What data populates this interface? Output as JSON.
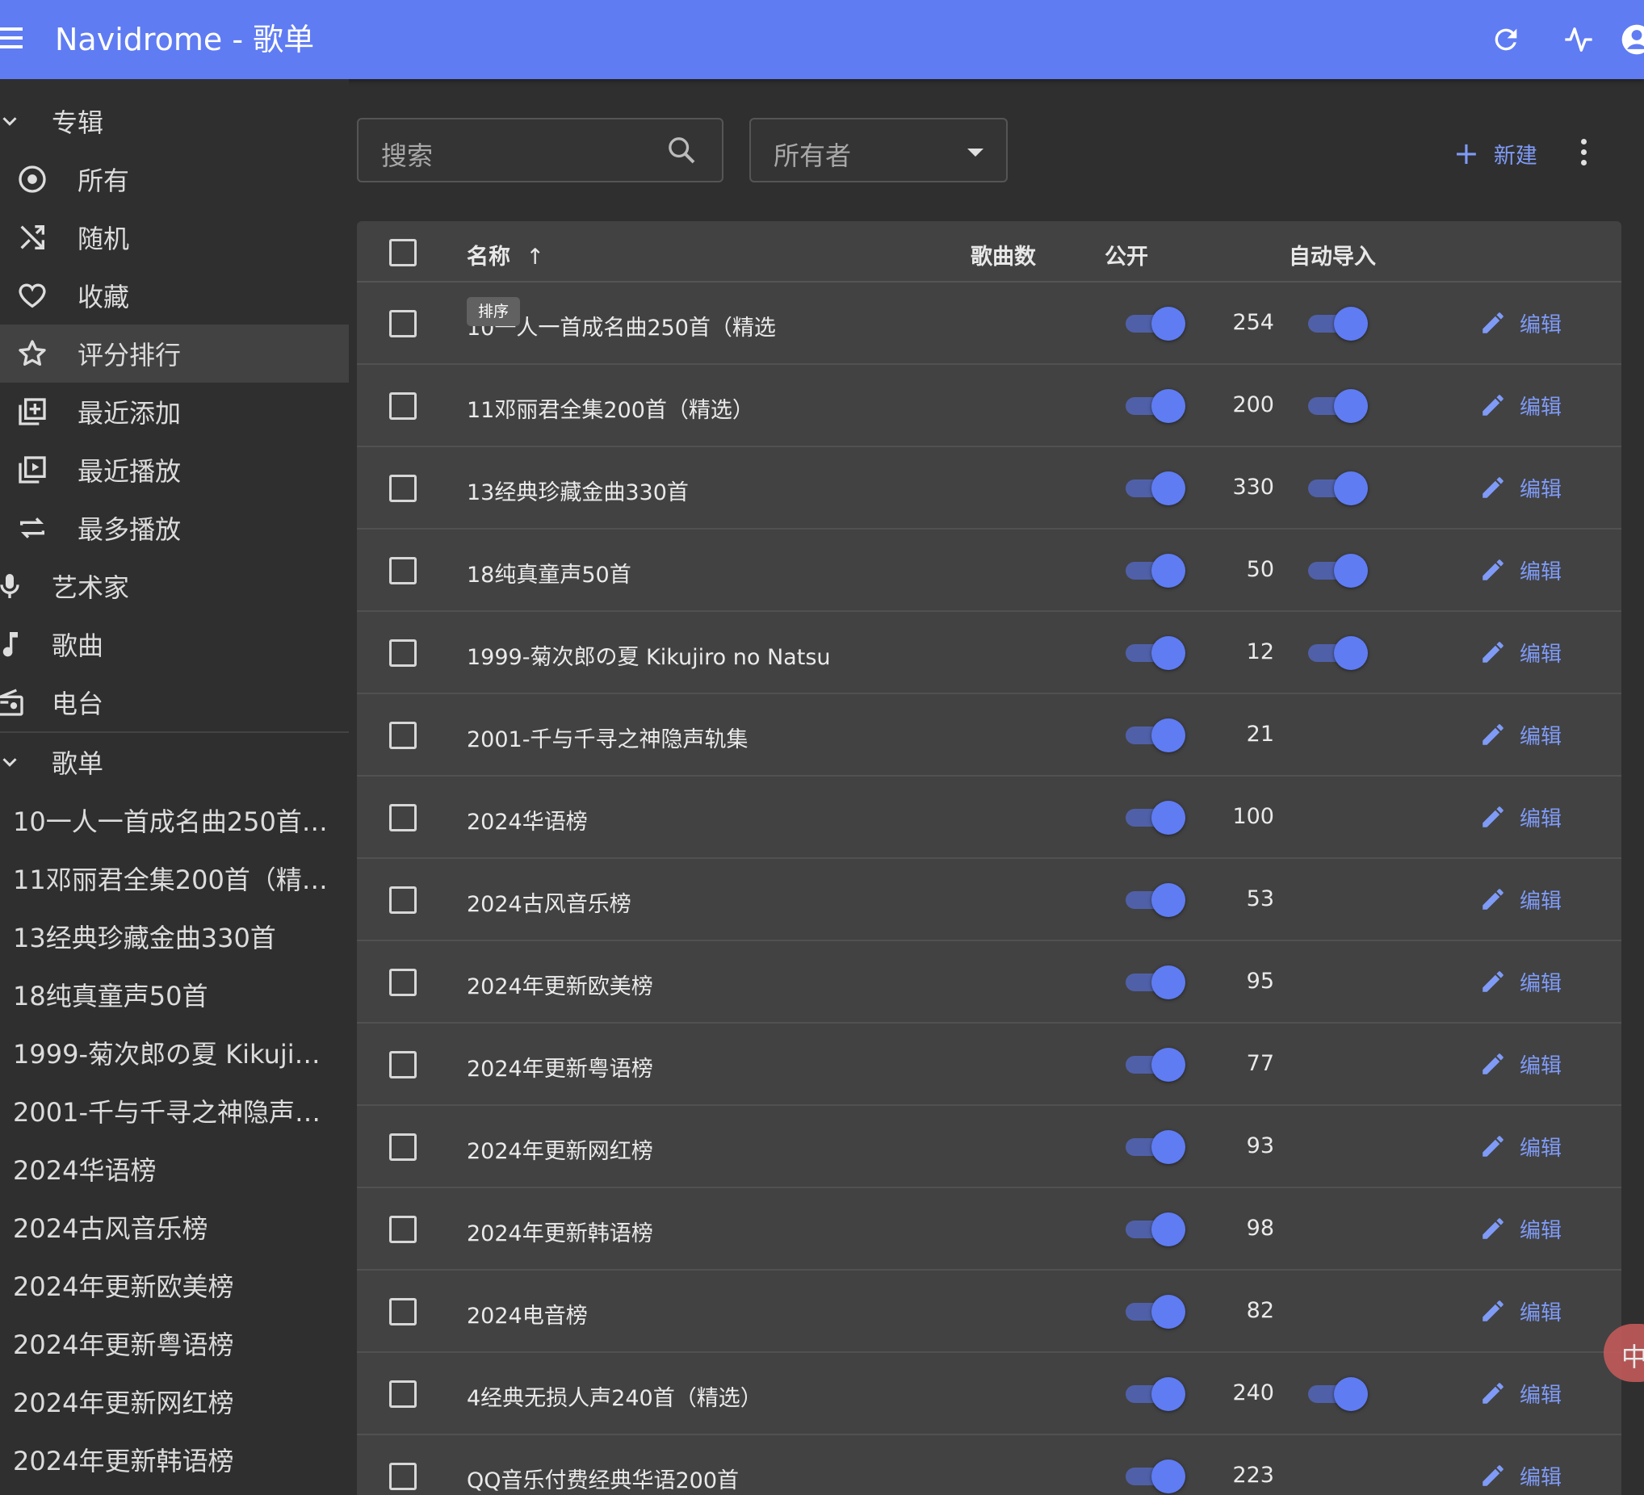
{
  "appbar": {
    "title": "Navidrome - 歌单",
    "icons": [
      "menu-icon",
      "refresh-icon",
      "activity-icon",
      "account-icon"
    ]
  },
  "sidebar": {
    "albums_section": "专辑",
    "album_items": [
      {
        "label": "所有",
        "icon": "album-icon"
      },
      {
        "label": "随机",
        "icon": "shuffle-icon"
      },
      {
        "label": "收藏",
        "icon": "heart-icon"
      },
      {
        "label": "评分排行",
        "icon": "star-icon",
        "active": true
      },
      {
        "label": "最近添加",
        "icon": "library-add-icon"
      },
      {
        "label": "最近播放",
        "icon": "video-library-icon"
      },
      {
        "label": "最多播放",
        "icon": "repeat-icon"
      }
    ],
    "main_items": [
      {
        "label": "艺术家",
        "icon": "mic-icon"
      },
      {
        "label": "歌曲",
        "icon": "music-note-icon"
      },
      {
        "label": "电台",
        "icon": "radio-icon"
      }
    ],
    "playlists_section": "歌单",
    "playlists": [
      "10一人一首成名曲250首…",
      "11邓丽君全集200首（精…",
      "13经典珍藏金曲330首",
      "18纯真童声50首",
      "1999-菊次郎の夏 Kikujir…",
      "2001-千与千寻之神隐声…",
      "2024华语榜",
      "2024古风音乐榜",
      "2024年更新欧美榜",
      "2024年更新粤语榜",
      "2024年更新网红榜",
      "2024年更新韩语榜"
    ]
  },
  "toolbar": {
    "search_placeholder": "搜索",
    "owner_select": "所有者",
    "new_label": "新建"
  },
  "table": {
    "headers": {
      "name": "名称",
      "count": "歌曲数",
      "public": "公开",
      "auto_import": "自动导入"
    },
    "sort_tooltip": "排序",
    "edit_label": "编辑",
    "rows": [
      {
        "name": "10一人一首成名曲250首（精选",
        "count": "254",
        "public": true,
        "auto_import": true
      },
      {
        "name": "11邓丽君全集200首（精选）",
        "count": "200",
        "public": true,
        "auto_import": true
      },
      {
        "name": "13经典珍藏金曲330首",
        "count": "330",
        "public": true,
        "auto_import": true
      },
      {
        "name": "18纯真童声50首",
        "count": "50",
        "public": true,
        "auto_import": true
      },
      {
        "name": "1999-菊次郎の夏 Kikujiro no Natsu",
        "count": "12",
        "public": true,
        "auto_import": true
      },
      {
        "name": "2001-千与千寻之神隐声轨集",
        "count": "21",
        "public": true,
        "auto_import": false
      },
      {
        "name": "2024华语榜",
        "count": "100",
        "public": true,
        "auto_import": false
      },
      {
        "name": "2024古风音乐榜",
        "count": "53",
        "public": true,
        "auto_import": false
      },
      {
        "name": "2024年更新欧美榜",
        "count": "95",
        "public": true,
        "auto_import": false
      },
      {
        "name": "2024年更新粤语榜",
        "count": "77",
        "public": true,
        "auto_import": false
      },
      {
        "name": "2024年更新网红榜",
        "count": "93",
        "public": true,
        "auto_import": false
      },
      {
        "name": "2024年更新韩语榜",
        "count": "98",
        "public": true,
        "auto_import": false
      },
      {
        "name": "2024电音榜",
        "count": "82",
        "public": true,
        "auto_import": false
      },
      {
        "name": "4经典无损人声240首（精选）",
        "count": "240",
        "public": true,
        "auto_import": true
      },
      {
        "name": "QQ音乐付费经典华语200首",
        "count": "223",
        "public": true,
        "auto_import": false
      }
    ]
  },
  "floating_tab": "中A",
  "colors": {
    "appbar": "#5f7cf3",
    "accent": "#7f9bf7",
    "background": "#2f2f2f",
    "surface": "#424242"
  }
}
